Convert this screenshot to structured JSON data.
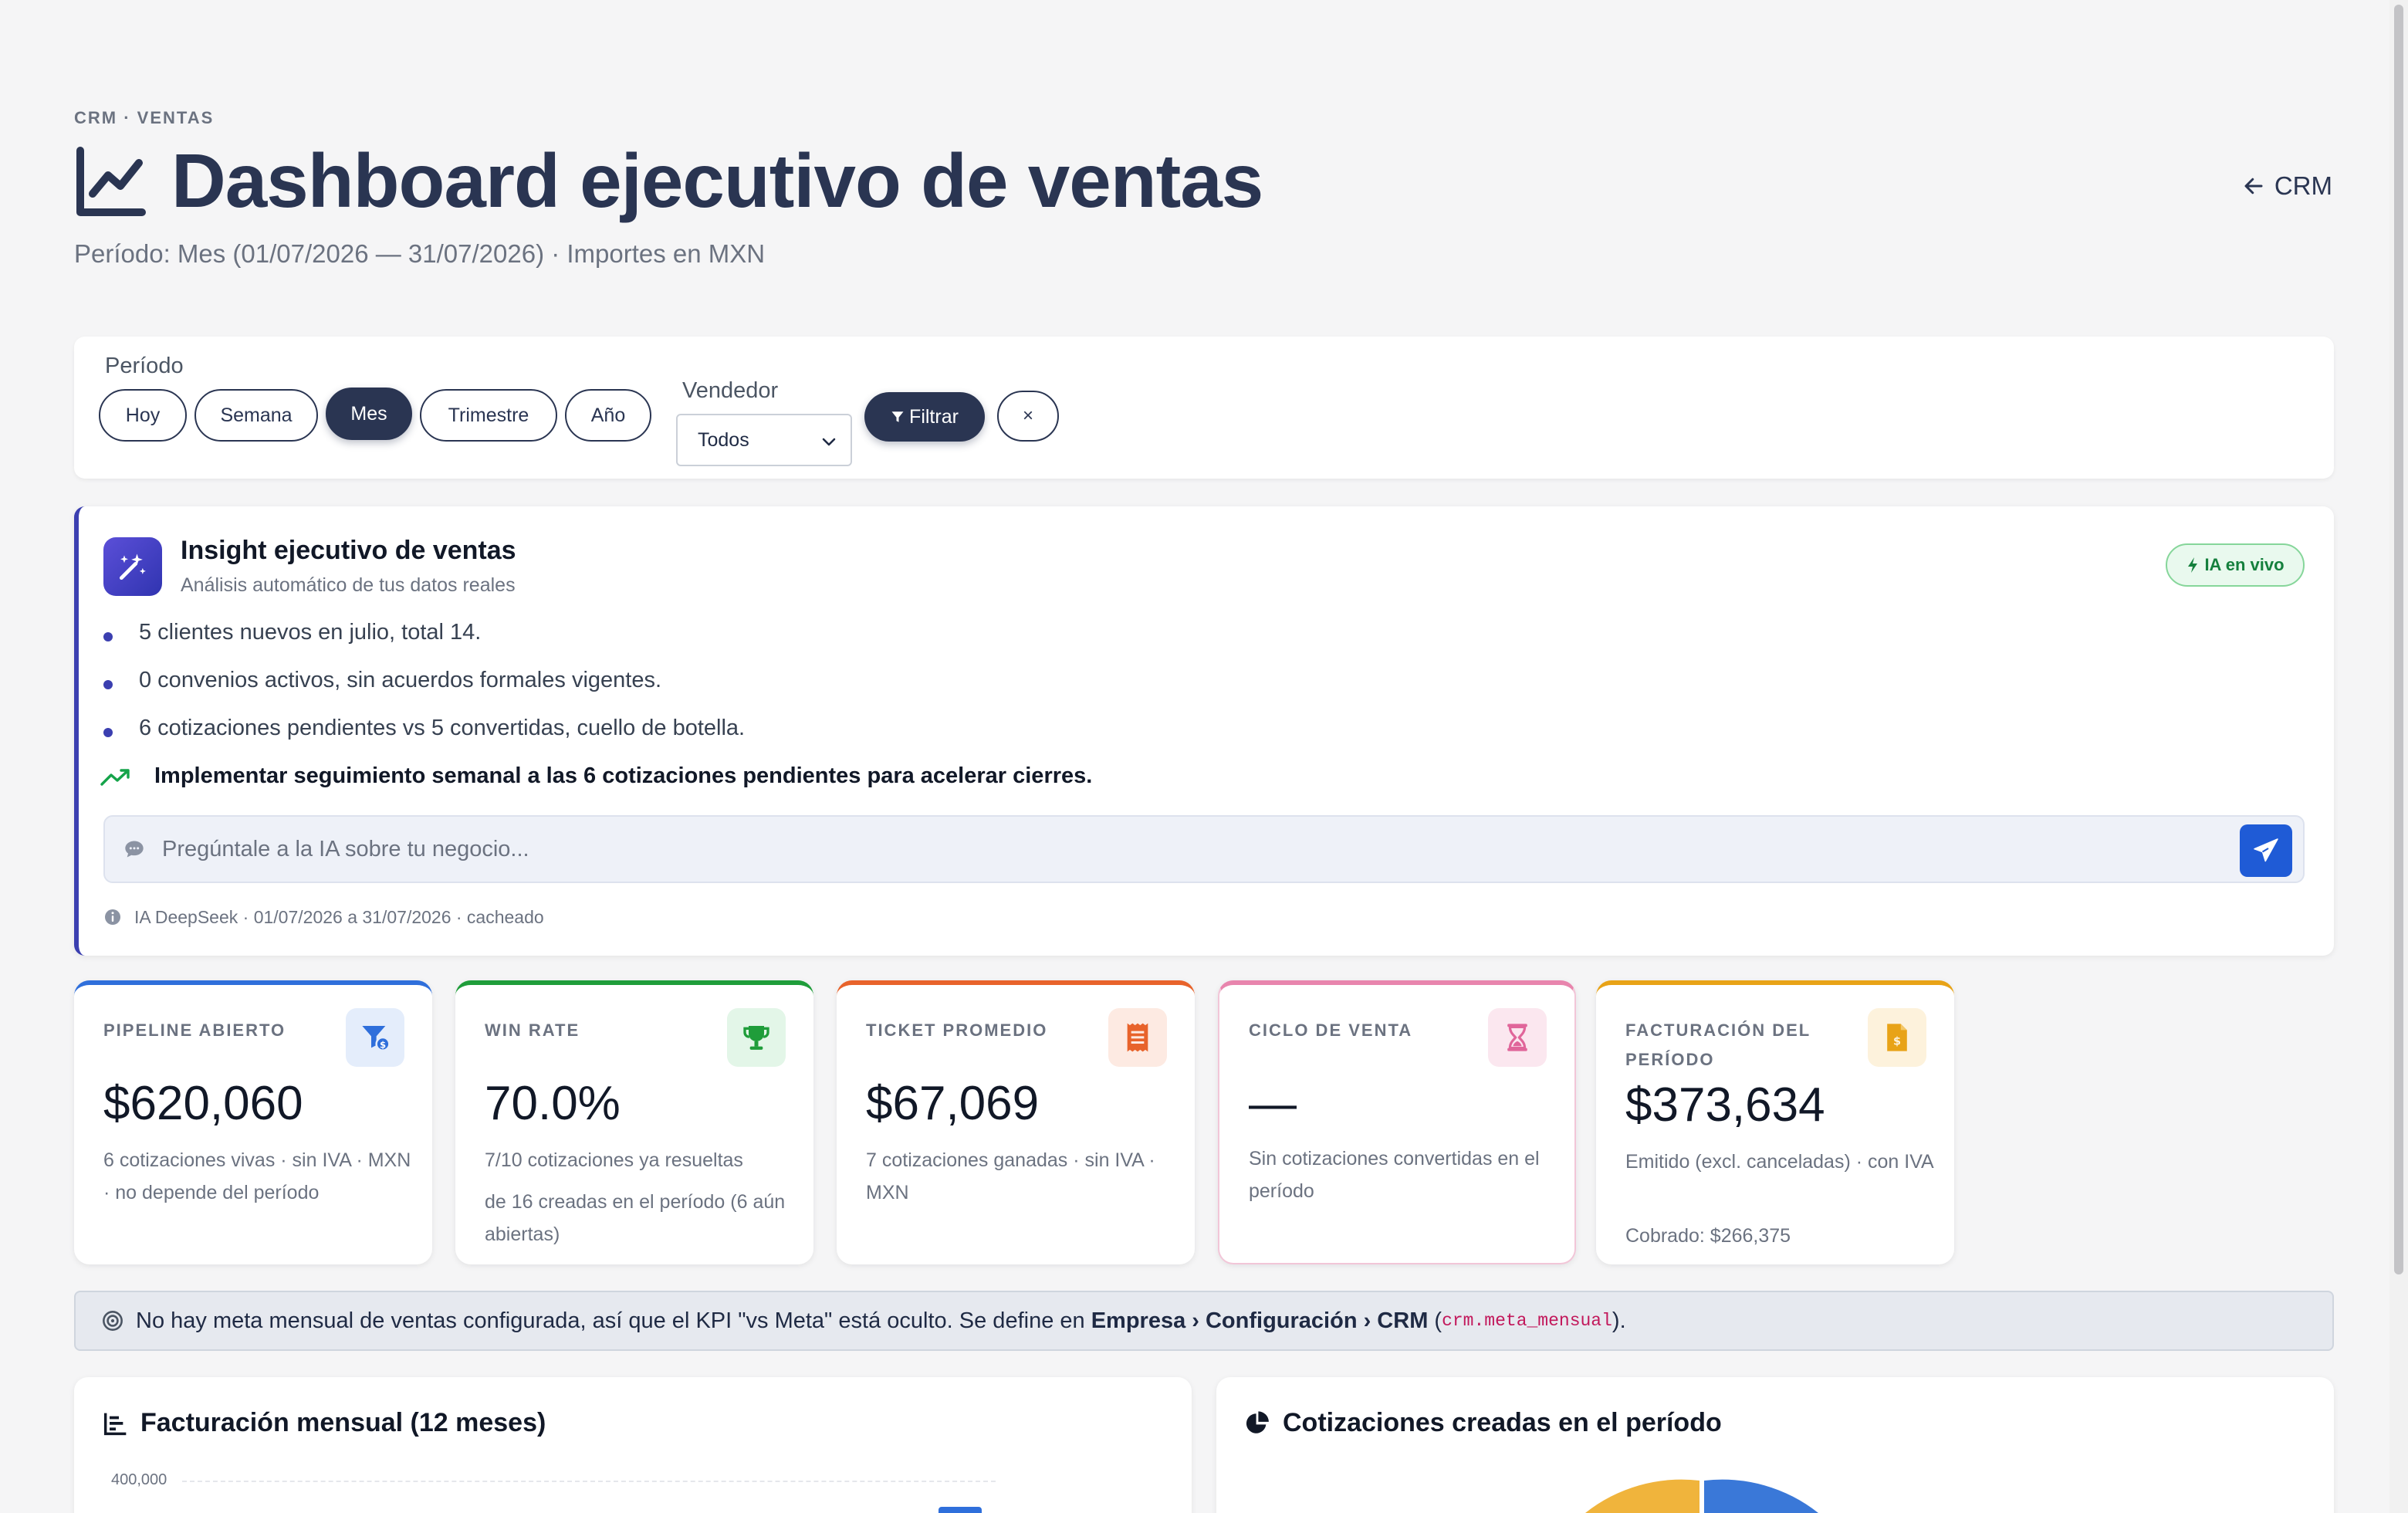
{
  "header": {
    "eyebrow": "CRM · VENTAS",
    "title": "Dashboard ejecutivo de ventas",
    "subtitle": "Período: Mes (01/07/2026 — 31/07/2026) · Importes en MXN",
    "back_link": "CRM"
  },
  "filters": {
    "period_label": "Período",
    "periods": [
      "Hoy",
      "Semana",
      "Mes",
      "Trimestre",
      "Año"
    ],
    "active_period": "Mes",
    "seller_label": "Vendedor",
    "seller_value": "Todos",
    "filter_button": "Filtrar",
    "clear_button": "×"
  },
  "insight": {
    "title": "Insight ejecutivo de ventas",
    "subtitle": "Análisis automático de tus datos reales",
    "badge": "IA en vivo",
    "bullets": [
      "5 clientes nuevos en julio, total 14.",
      "0 convenios activos, sin acuerdos formales vigentes.",
      "6 cotizaciones pendientes vs 5 convertidas, cuello de botella."
    ],
    "recommendation": "Implementar seguimiento semanal a las 6 cotizaciones pendientes para acelerar cierres.",
    "ask_placeholder": "Pregúntale a la IA sobre tu negocio...",
    "meta": "IA DeepSeek · 01/07/2026 a 31/07/2026 · cacheado"
  },
  "kpis": [
    {
      "label": "PIPELINE ABIERTO",
      "value": "$620,060",
      "desc1": "6 cotizaciones vivas · sin IVA · MXN · no depende del período",
      "desc2": "",
      "color": "#2f6fdb",
      "icon_bg": "#e4edfb",
      "icon": "funnel-dollar-icon"
    },
    {
      "label": "WIN RATE",
      "value": "70.0%",
      "desc1": "7/10 cotizaciones ya resueltas",
      "desc2": "de 16 creadas en el período (6 aún abiertas)",
      "color": "#1f9d3a",
      "icon_bg": "#e3f6e8",
      "icon": "trophy-icon"
    },
    {
      "label": "TICKET PROMEDIO",
      "value": "$67,069",
      "desc1": "7 cotizaciones ganadas · sin IVA · MXN",
      "desc2": "",
      "color": "#e8632b",
      "icon_bg": "#fdeae2",
      "icon": "receipt-icon"
    },
    {
      "label": "CICLO DE VENTA",
      "value": "—",
      "desc1": "Sin cotizaciones convertidas en el período",
      "desc2": "",
      "color": "#e885ad",
      "icon_bg": "#fbe7ef",
      "icon": "hourglass-icon"
    },
    {
      "label": "FACTURACIÓN DEL PERÍODO",
      "value": "$373,634",
      "desc1": "Emitido (excl. canceladas) · con IVA",
      "desc2": "Cobrado: $266,375",
      "color": "#e8a317",
      "icon_bg": "#fdf2dc",
      "icon": "invoice-dollar-icon"
    }
  ],
  "info_bar": {
    "text_before": "No hay meta mensual de ventas configurada, así que el KPI \"vs Meta\" está oculto. Se define en ",
    "path": "Empresa › Configuración › CRM",
    "paren_open": " (",
    "code": "crm.meta_mensual",
    "paren_close": ")."
  },
  "charts": {
    "billing_title": "Facturación mensual (12 meses)",
    "billing_tick": "400,000",
    "quotes_title": "Cotizaciones creadas en el período"
  }
}
